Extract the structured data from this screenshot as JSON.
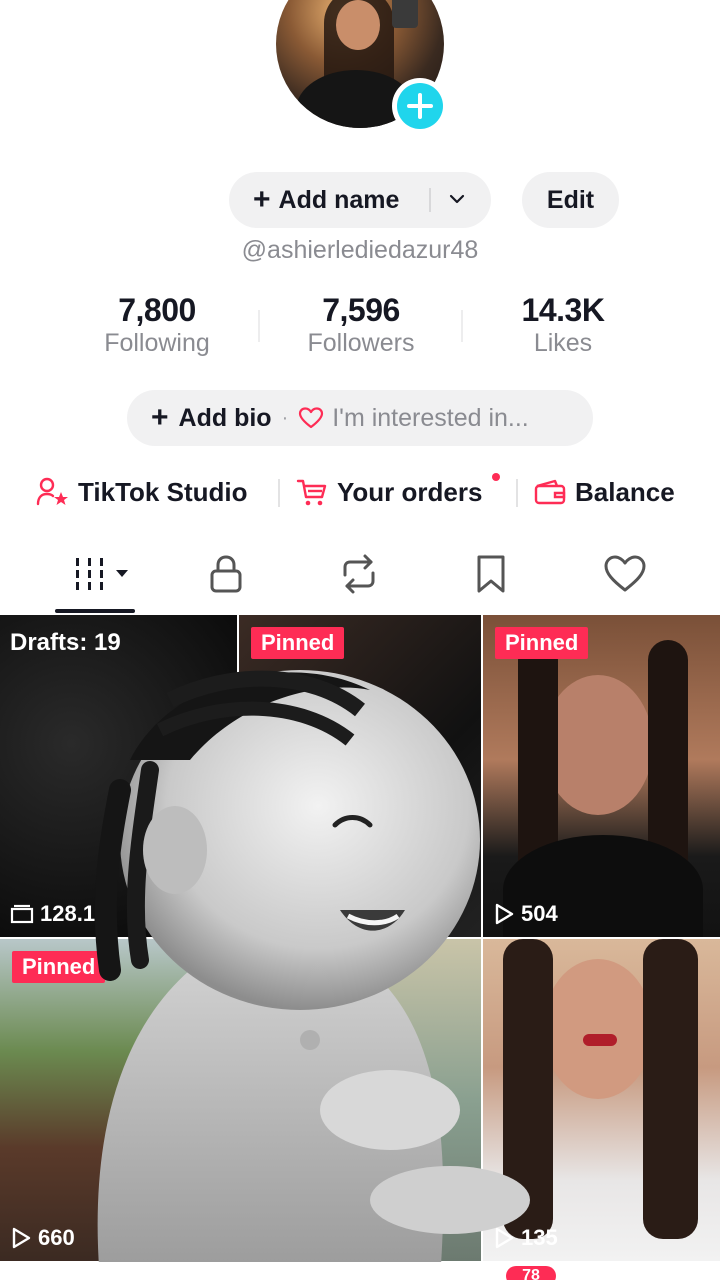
{
  "profile": {
    "add_name_plus": "+",
    "add_name_label": "Add name",
    "edit_label": "Edit",
    "username": "@ashierlediedazur48"
  },
  "stats": [
    {
      "value": "7,800",
      "label": "Following"
    },
    {
      "value": "7,596",
      "label": "Followers"
    },
    {
      "value": "14.3K",
      "label": "Likes"
    }
  ],
  "bio": {
    "plus": "+",
    "add_bio_label": "Add bio",
    "separator": "·",
    "interests_placeholder": "I'm interested in..."
  },
  "shortcuts": [
    {
      "label": "TikTok Studio",
      "icon": "person-star-icon"
    },
    {
      "label": "Your orders",
      "icon": "cart-icon"
    },
    {
      "label": "Balance",
      "icon": "wallet-icon"
    }
  ],
  "tabs": [
    {
      "name": "videos-grid-icon"
    },
    {
      "name": "lock-icon"
    },
    {
      "name": "repost-icon"
    },
    {
      "name": "bookmark-icon"
    },
    {
      "name": "heart-icon"
    }
  ],
  "grid": [
    {
      "drafts_label": "Drafts: 19",
      "count": "128.1"
    },
    {
      "pinned_label": "Pinned"
    },
    {
      "pinned_label": "Pinned",
      "views": "504"
    },
    {
      "pinned_label": "Pinned",
      "views": "660"
    },
    {
      "views": "135"
    }
  ],
  "nav": {
    "inbox_badge": "78"
  },
  "colors": {
    "accent": "#fe2c55",
    "badge": "#20d5ec",
    "muted": "#8a8b91"
  }
}
